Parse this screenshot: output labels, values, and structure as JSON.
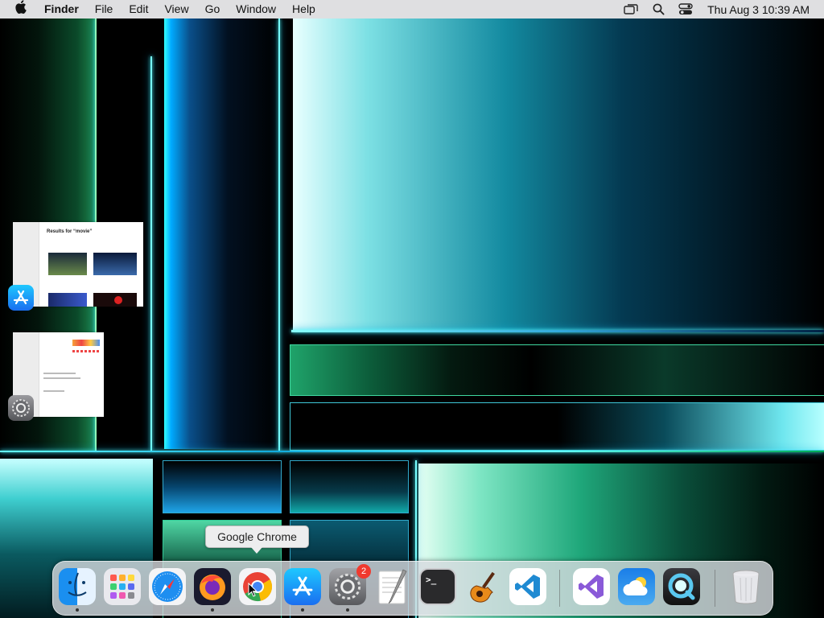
{
  "menubar": {
    "app_name": "Finder",
    "menus": [
      "File",
      "Edit",
      "View",
      "Go",
      "Window",
      "Help"
    ],
    "clock": "Thu Aug 3  10:39 AM",
    "status_icons": [
      "screen-mirroring-icon",
      "search-icon",
      "control-center-icon"
    ]
  },
  "windows": [
    {
      "app": "App Store",
      "title": "Results for “movie”"
    },
    {
      "app": "System Settings",
      "title": ""
    }
  ],
  "tooltip": {
    "text": "Google Chrome"
  },
  "dock": {
    "items": [
      {
        "name": "Finder",
        "running": true
      },
      {
        "name": "Launchpad",
        "running": false
      },
      {
        "name": "Safari",
        "running": false
      },
      {
        "name": "Firefox",
        "running": true
      },
      {
        "name": "Google Chrome",
        "running": false,
        "hovered": true
      },
      {
        "name": "App Store",
        "running": true
      },
      {
        "name": "System Settings",
        "running": true,
        "badge": "2"
      },
      {
        "name": "TextEdit",
        "running": false
      },
      {
        "name": "Terminal",
        "running": false
      },
      {
        "name": "GarageBand",
        "running": false
      },
      {
        "name": "Visual Studio Code",
        "running": false
      },
      {
        "name": "Visual Studio",
        "running": false
      },
      {
        "name": "Weather",
        "running": false
      },
      {
        "name": "QuickTime Player",
        "running": false
      },
      {
        "name": "Trash",
        "running": false
      }
    ]
  },
  "colors": {
    "menubar_bg": "#e8e8ea",
    "badge": "#f03a2e",
    "tooltip_bg": "#ededee",
    "wallpaper_accent": "#2fd6c8"
  }
}
